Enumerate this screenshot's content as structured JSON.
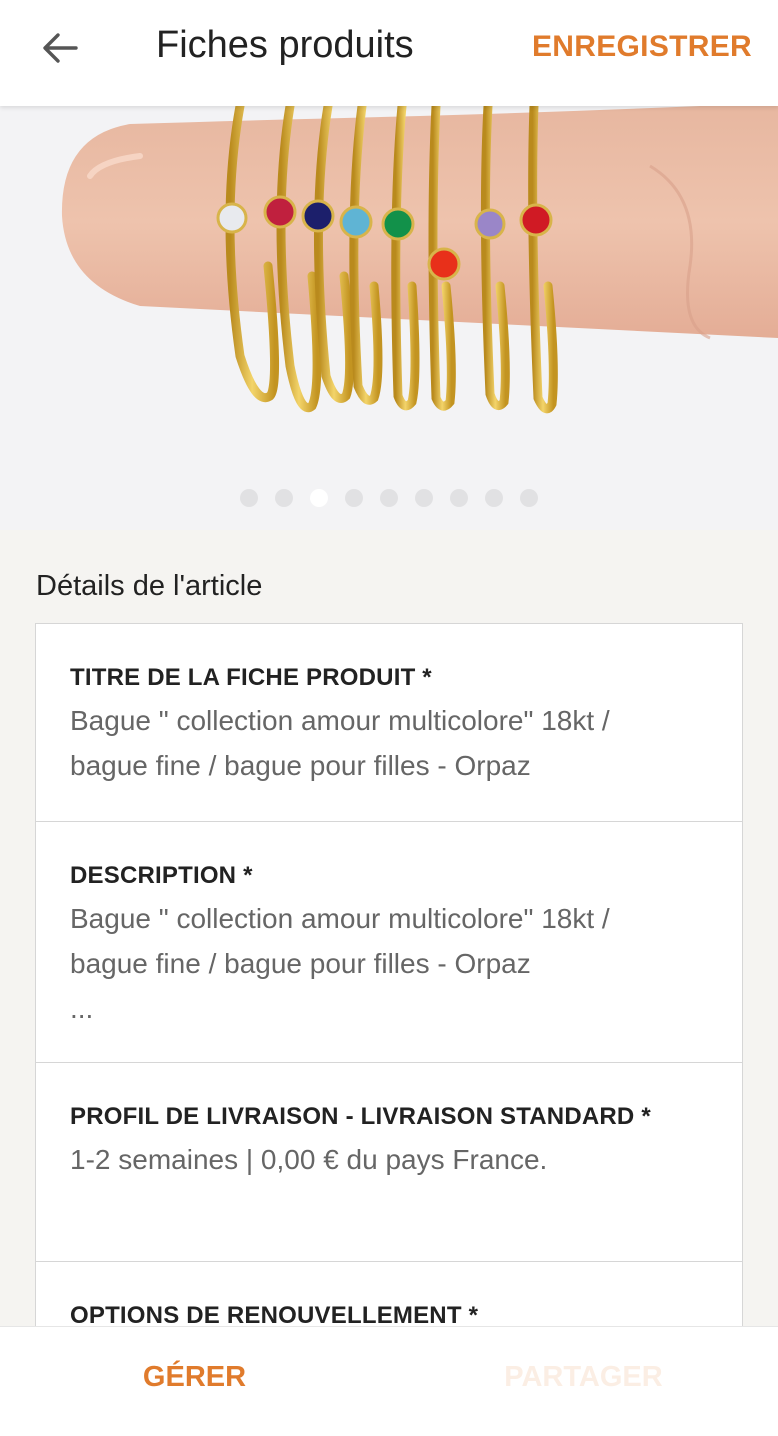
{
  "header": {
    "back_icon": "arrow-left-icon",
    "title": "Fiches produits",
    "save_label": "ENREGISTRER"
  },
  "colors": {
    "accent": "#e07b2c",
    "accent_disabled": "#fbeee4",
    "background": "#f5f4f1"
  },
  "hero": {
    "image_subject": "gold stacking rings with colored gemstones on a finger",
    "carousel": {
      "total": 9,
      "active_index": 2
    }
  },
  "details": {
    "section_title": "Détails de l'article",
    "fields": [
      {
        "label": "TITRE DE LA FICHE PRODUIT *",
        "value": "Bague \" collection amour multicolore\" 18kt  /\nbague fine / bague pour filles - Orpaz"
      },
      {
        "label": "DESCRIPTION *",
        "value": "Bague \" collection amour multicolore\" 18kt  /\nbague fine / bague pour filles - Orpaz\n..."
      },
      {
        "label": "PROFIL DE LIVRAISON - LIVRAISON STANDARD *",
        "value": "1-2 semaines | 0,00 € du pays France."
      },
      {
        "label": "OPTIONS DE RENOUVELLEMENT *",
        "value": ""
      }
    ]
  },
  "bottom": {
    "manage_label": "GÉRER",
    "share_label": "PARTAGER"
  }
}
